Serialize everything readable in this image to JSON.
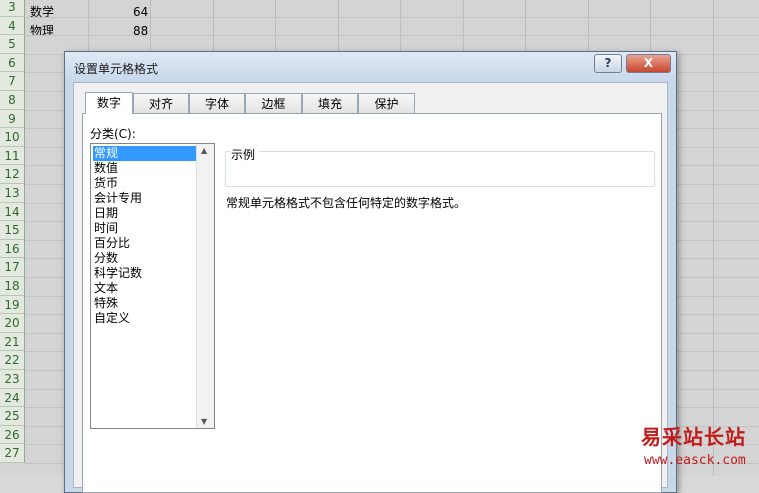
{
  "sheet": {
    "rows": [
      "3",
      "4",
      "5",
      "6",
      "7",
      "8",
      "9",
      "10",
      "11",
      "12",
      "13",
      "14",
      "15",
      "16",
      "17",
      "18",
      "19",
      "20",
      "21",
      "22",
      "23",
      "24",
      "25",
      "26",
      "27"
    ],
    "cells": [
      {
        "name": "数学",
        "value": "64"
      },
      {
        "name": "物理",
        "value": "88"
      }
    ]
  },
  "dialog": {
    "title": "设置单元格格式",
    "help_label": "?",
    "close_label": "X",
    "tabs": [
      "数字",
      "对齐",
      "字体",
      "边框",
      "填充",
      "保护"
    ],
    "active_tab": "数字",
    "category_label": "分类(C):",
    "categories": [
      "常规",
      "数值",
      "货币",
      "会计专用",
      "日期",
      "时间",
      "百分比",
      "分数",
      "科学记数",
      "文本",
      "特殊",
      "自定义"
    ],
    "selected_category": "常规",
    "sample_label": "示例",
    "description": "常规单元格格式不包含任何特定的数字格式。"
  },
  "watermark": {
    "title": "易采站长站",
    "url": "www.easck.com"
  },
  "colors": {
    "selection": "#3399ff",
    "row_header": "#e3e9df",
    "close_button": "#c8482d",
    "watermark": "#c11c1c"
  }
}
